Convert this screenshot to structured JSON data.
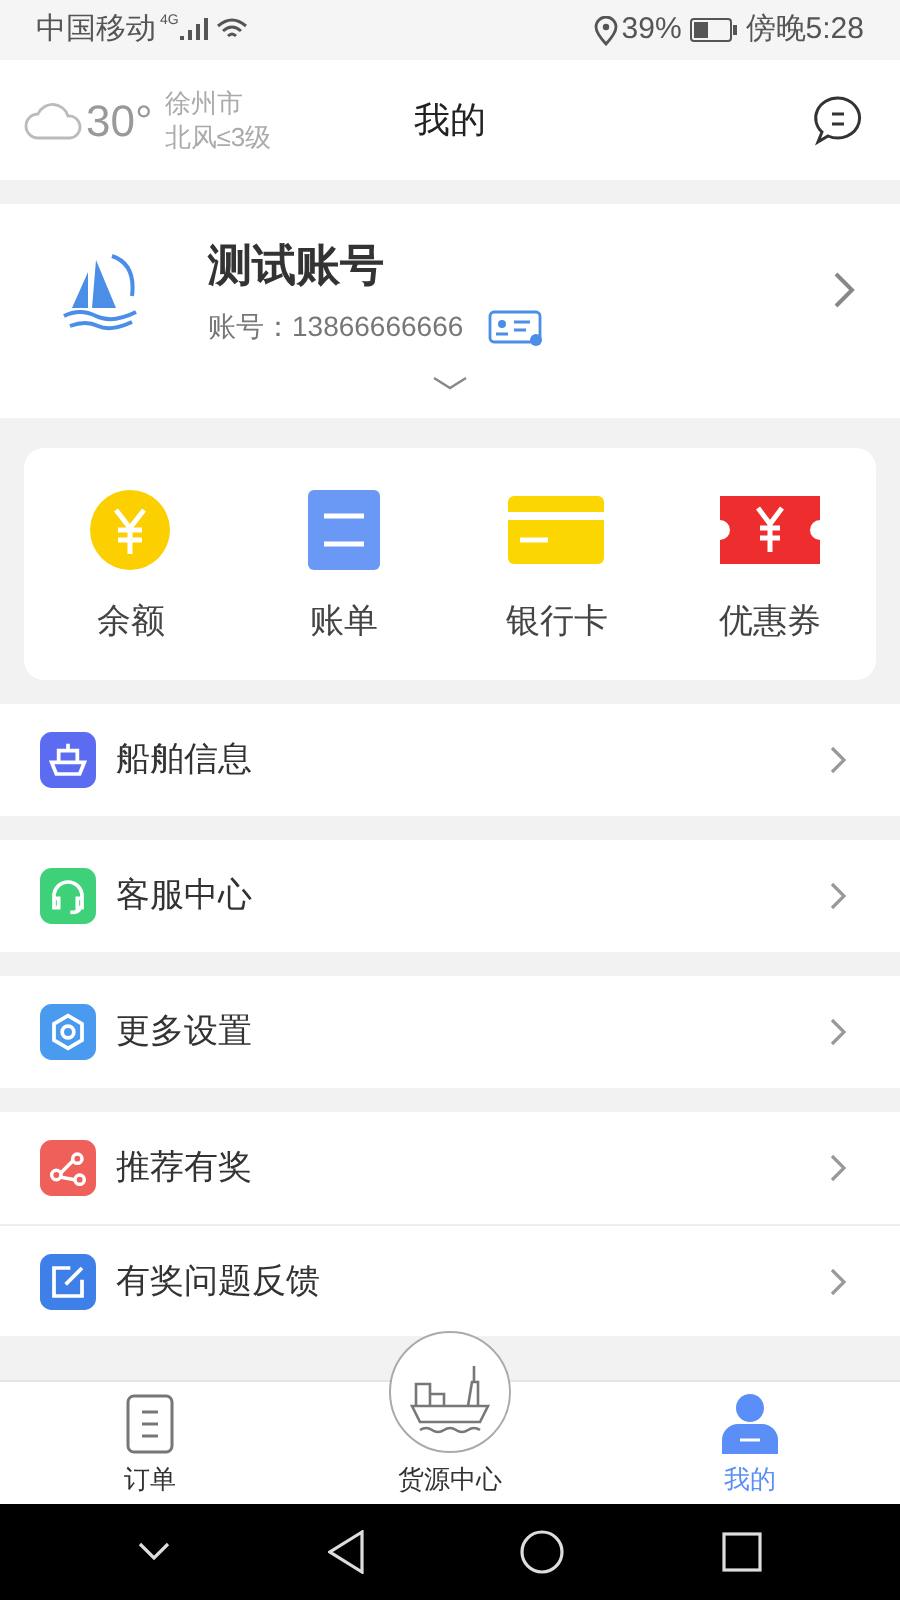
{
  "status_bar": {
    "carrier": "中国移动",
    "network": "4G",
    "battery": "39%",
    "time": "傍晚5:28"
  },
  "header": {
    "temperature": "30°",
    "city": "徐州市",
    "wind": "北风≤3级",
    "title": "我的"
  },
  "profile": {
    "name": "测试账号",
    "account": "账号：13866666666"
  },
  "quick_actions": [
    {
      "label": "余额",
      "kind": "coin"
    },
    {
      "label": "账单",
      "kind": "bill"
    },
    {
      "label": "银行卡",
      "kind": "card"
    },
    {
      "label": "优惠券",
      "kind": "coupon"
    }
  ],
  "menu_groups": [
    [
      {
        "label": "船舶信息",
        "kind": "ship",
        "color": "#5b6cf0"
      }
    ],
    [
      {
        "label": "客服中心",
        "kind": "headset",
        "color": "#3ed17a"
      }
    ],
    [
      {
        "label": "更多设置",
        "kind": "gear",
        "color": "#4a9bf0"
      }
    ],
    [
      {
        "label": "推荐有奖",
        "kind": "share",
        "color": "#f0605a"
      },
      {
        "label": "有奖问题反馈",
        "kind": "edit",
        "color": "#3f7fe8"
      }
    ]
  ],
  "tabs": [
    {
      "label": "订单",
      "kind": "doc",
      "selected": false
    },
    {
      "label": "货源中心",
      "kind": "ship",
      "selected": false
    },
    {
      "label": "我的",
      "kind": "person",
      "selected": true
    }
  ]
}
